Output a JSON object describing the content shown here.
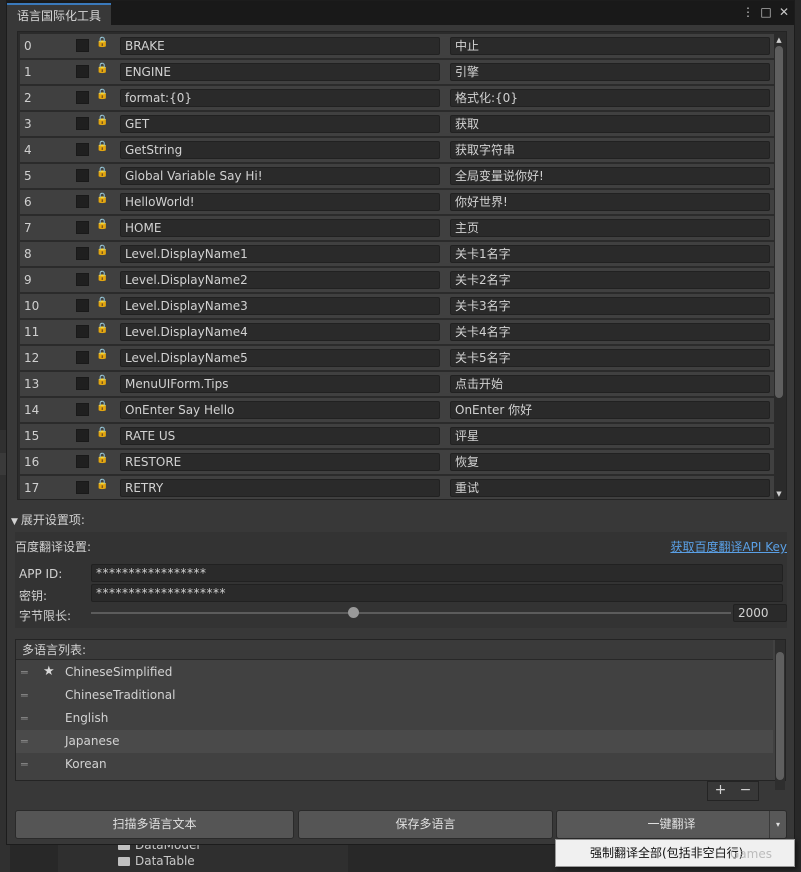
{
  "window": {
    "tab_title": "语言国际化工具",
    "menu_icon": "kebab-menu-icon",
    "maximize_icon": "maximize-icon",
    "close_icon": "close-icon"
  },
  "entries": [
    {
      "index": "0",
      "key": "BRAKE",
      "value": "中止"
    },
    {
      "index": "1",
      "key": "ENGINE",
      "value": "引擎"
    },
    {
      "index": "2",
      "key": "format:{0}",
      "value": "格式化:{0}"
    },
    {
      "index": "3",
      "key": "GET",
      "value": "获取"
    },
    {
      "index": "4",
      "key": "GetString",
      "value": "获取字符串"
    },
    {
      "index": "5",
      "key": "Global Variable Say Hi!",
      "value": "全局变量说你好!"
    },
    {
      "index": "6",
      "key": "HelloWorld!",
      "value": "你好世界!"
    },
    {
      "index": "7",
      "key": "HOME",
      "value": "主页"
    },
    {
      "index": "8",
      "key": "Level.DisplayName1",
      "value": "关卡1名字"
    },
    {
      "index": "9",
      "key": "Level.DisplayName2",
      "value": "关卡2名字"
    },
    {
      "index": "10",
      "key": "Level.DisplayName3",
      "value": "关卡3名字"
    },
    {
      "index": "11",
      "key": "Level.DisplayName4",
      "value": "关卡4名字"
    },
    {
      "index": "12",
      "key": "Level.DisplayName5",
      "value": "关卡5名字"
    },
    {
      "index": "13",
      "key": "MenuUIForm.Tips",
      "value": "点击开始"
    },
    {
      "index": "14",
      "key": "OnEnter Say Hello",
      "value": "OnEnter 你好"
    },
    {
      "index": "15",
      "key": "RATE US",
      "value": "评星"
    },
    {
      "index": "16",
      "key": "RESTORE",
      "value": "恢复"
    },
    {
      "index": "17",
      "key": "RETRY",
      "value": "重试"
    }
  ],
  "settings": {
    "foldout_label": "展开设置项:",
    "baidu_title": "百度翻译设置:",
    "get_key_link": "获取百度翻译API Key",
    "app_id_label": "APP ID:",
    "app_id_value": "*****************",
    "secret_label": "密钥:",
    "secret_value": "********************",
    "byte_limit_label": "字节限长:",
    "byte_limit_value": "2000",
    "byte_limit_fraction": 0.41
  },
  "languages": {
    "header": "多语言列表:",
    "items": [
      {
        "name": "ChineseSimplified",
        "star": "★"
      },
      {
        "name": "ChineseTraditional",
        "star": ""
      },
      {
        "name": "English",
        "star": ""
      },
      {
        "name": "Japanese",
        "star": ""
      },
      {
        "name": "Korean",
        "star": ""
      }
    ],
    "add_label": "+",
    "remove_label": "−"
  },
  "buttons": {
    "scan": "扫描多语言文本",
    "save": "保存多语言",
    "translate": "一键翻译",
    "dropdown_arrow": "▾"
  },
  "popup": {
    "force_translate": "强制翻译全部(包括非空白行)"
  },
  "background": {
    "folder_item_1": "DataModel",
    "folder_item_2": "DataTable",
    "watermark": "Games"
  }
}
